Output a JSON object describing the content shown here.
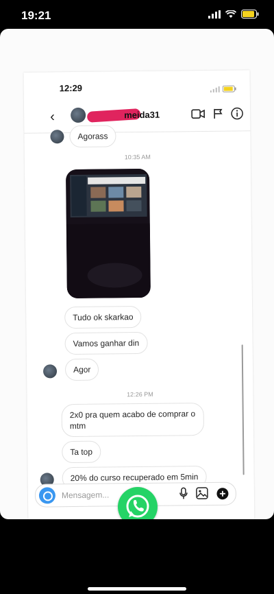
{
  "outer_status": {
    "time": "19:21"
  },
  "inner_status": {
    "time": "12:29"
  },
  "header": {
    "username": "meida31"
  },
  "messages": [
    {
      "id": "agorass",
      "text": "Agorass"
    },
    {
      "id": "tudo",
      "text": "Tudo ok skarkao"
    },
    {
      "id": "vamos",
      "text": "Vamos ganhar din"
    },
    {
      "id": "agor",
      "text": "Agor"
    },
    {
      "id": "2x0",
      "text": "2x0 pra quem acabo de comprar o mtm"
    },
    {
      "id": "tatop",
      "text": "Ta top"
    },
    {
      "id": "curso",
      "text": "20% do curso recuperado em 5min"
    }
  ],
  "timestamps": {
    "t1": "10:35 AM",
    "t2": "12:26 PM"
  },
  "composer": {
    "placeholder": "Mensagem..."
  },
  "colors": {
    "accent_blue": "#3a97f0",
    "whatsapp_green": "#25d366",
    "redaction": "#e0245e"
  },
  "icons": [
    "back-icon",
    "video-call-icon",
    "flag-icon",
    "info-icon",
    "camera-icon",
    "microphone-icon",
    "gallery-icon",
    "add-icon",
    "whatsapp-logo"
  ]
}
